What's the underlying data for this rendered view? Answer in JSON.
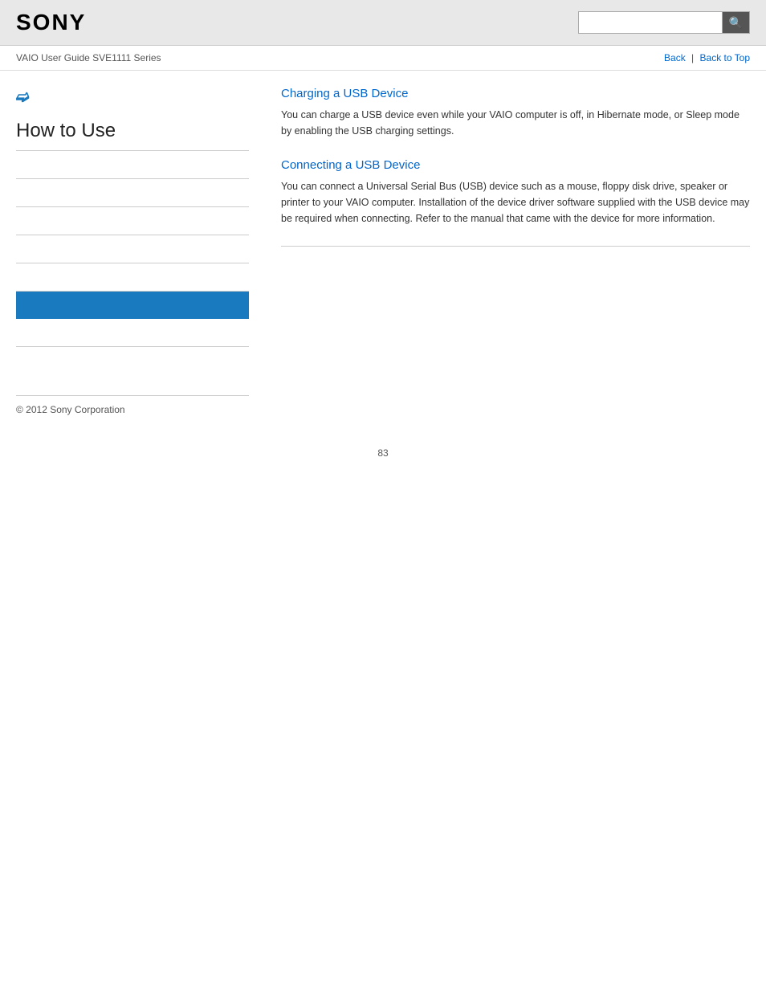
{
  "header": {
    "logo": "SONY",
    "search_placeholder": ""
  },
  "sub_header": {
    "guide_title": "VAIO User Guide SVE1111 Series",
    "back_label": "Back",
    "back_to_top_label": "Back to Top"
  },
  "sidebar": {
    "chevron": "❯",
    "section_title": "How to Use",
    "nav_items": [
      {
        "label": "",
        "highlighted": false
      },
      {
        "label": "",
        "highlighted": false
      },
      {
        "label": "",
        "highlighted": false
      },
      {
        "label": "",
        "highlighted": false
      },
      {
        "label": "",
        "highlighted": false
      },
      {
        "label": "",
        "highlighted": true
      },
      {
        "label": "",
        "highlighted": false
      }
    ]
  },
  "content": {
    "sections": [
      {
        "id": "charging-usb",
        "title": "Charging a USB Device",
        "body": "You can charge a USB device even while your VAIO computer is off, in Hibernate mode, or Sleep mode by enabling the USB charging settings."
      },
      {
        "id": "connecting-usb",
        "title": "Connecting a USB Device",
        "body": "You can connect a Universal Serial Bus (USB) device such as a mouse, floppy disk drive, speaker or printer to your VAIO computer. Installation of the device driver software supplied with the USB device may be required when connecting. Refer to the manual that came with the device for more information."
      }
    ]
  },
  "footer": {
    "copyright": "© 2012 Sony Corporation",
    "page_number": "83"
  },
  "icons": {
    "search": "🔍"
  },
  "colors": {
    "accent": "#1a7abf",
    "link": "#0066cc",
    "text": "#333",
    "subtext": "#555",
    "border": "#ccc",
    "header_bg": "#e8e8e8",
    "highlight_bg": "#1a7abf"
  }
}
